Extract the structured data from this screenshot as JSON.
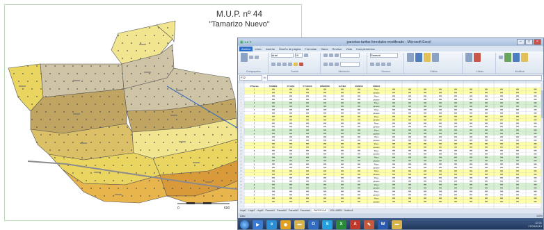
{
  "map": {
    "title_line1": "M.U.P. nº 44",
    "title_line2": "\"Tamarizo Nuevo\"",
    "scale_labels": [
      "0",
      "500"
    ],
    "colors": {
      "light_yellow": "#f1e58f",
      "yellow": "#ead561",
      "beige": "#cfc3a6",
      "tan": "#c0a562",
      "orange_light": "#e8b44c",
      "orange": "#d99b3a",
      "mustard": "#dcc067",
      "border": "#555555",
      "leader_line": "#3d6fb5"
    }
  },
  "excel": {
    "window_title": "parcelas tarifas forestales modificado - Microsoft Excel",
    "quick_access_icon": "excel-logo-icon",
    "ribbon_tabs": [
      "Archivo",
      "Inicio",
      "Insertar",
      "Diseño de página",
      "Fórmulas",
      "Datos",
      "Revisar",
      "Vista",
      "Complementos"
    ],
    "ribbon_groups": [
      "Portapapeles",
      "Fuente",
      "Alineación",
      "Número",
      "Estilos",
      "Celdas",
      "Modificar"
    ],
    "font_name": "Arial",
    "font_size": "10",
    "number_format": "General",
    "name_box": "F12",
    "fx_label": "fx",
    "column_headers": [
      "NºParcela",
      "NºARBOL",
      "Nº VARA",
      "Nº SAVIAS",
      "DIÁMETRO",
      "ALTURA",
      "ESPECIE",
      "CÓDIGO"
    ],
    "sheet_tabs": [
      "Hoja1",
      "Hoja2",
      "Hoja3",
      "Parcela1",
      "Parcela2",
      "Parcela3",
      "Parcela4",
      "PARCELAS",
      "VOLUMEN",
      "Gráfico1"
    ],
    "status_left": "Listo",
    "status_right": "100%",
    "row_data": [
      {
        "id": "1",
        "plot": "1",
        "label": "Pinus"
      },
      {
        "id": "2",
        "plot": "1",
        "label": "pinaster"
      },
      {
        "id": "3",
        "plot": "1",
        "label": "Pinus"
      },
      {
        "id": "4",
        "plot": "1",
        "label": "pinaster"
      },
      {
        "id": "5",
        "plot": "2",
        "label": "Pinus"
      },
      {
        "id": "6",
        "plot": "2",
        "label": "pinaster"
      },
      {
        "id": "7",
        "plot": "2",
        "label": "Pinus"
      },
      {
        "id": "8",
        "plot": "2",
        "label": "pinaster"
      },
      {
        "id": "9",
        "plot": "3",
        "label": "Pinus"
      },
      {
        "id": "10",
        "plot": "3",
        "label": "pinaster"
      },
      {
        "id": "11",
        "plot": "3",
        "label": "Pinus"
      },
      {
        "id": "12",
        "plot": "3",
        "label": "pinaster"
      },
      {
        "id": "13",
        "plot": "4",
        "label": "Pinus"
      },
      {
        "id": "14",
        "plot": "4",
        "label": "pinaster"
      },
      {
        "id": "15",
        "plot": "4",
        "label": "Pinus"
      },
      {
        "id": "16",
        "plot": "4",
        "label": "pinaster"
      },
      {
        "id": "17",
        "plot": "5",
        "label": "Pinus"
      },
      {
        "id": "18",
        "plot": "5",
        "label": "pinaster"
      },
      {
        "id": "19",
        "plot": "5",
        "label": "Pinus"
      },
      {
        "id": "20",
        "plot": "5",
        "label": "pinaster"
      },
      {
        "id": "21",
        "plot": "6",
        "label": "Pinus"
      },
      {
        "id": "22",
        "plot": "6",
        "label": "pinaster"
      },
      {
        "id": "23",
        "plot": "6",
        "label": "Pinus"
      },
      {
        "id": "24",
        "plot": "6",
        "label": "pinaster"
      },
      {
        "id": "25",
        "plot": "7",
        "label": "Pinus"
      },
      {
        "id": "26",
        "plot": "7",
        "label": "pinaster"
      },
      {
        "id": "27",
        "plot": "7",
        "label": "Pinus"
      },
      {
        "id": "28",
        "plot": "7",
        "label": "pinaster"
      },
      {
        "id": "29",
        "plot": "8",
        "label": "Pinus"
      },
      {
        "id": "30",
        "plot": "8",
        "label": "pinaster"
      },
      {
        "id": "31",
        "plot": "8",
        "label": "Pinus"
      },
      {
        "id": "32",
        "plot": "8",
        "label": "pinaster"
      },
      {
        "id": "33",
        "plot": "9",
        "label": "Pinus"
      },
      {
        "id": "34",
        "plot": "9",
        "label": "pinaster"
      }
    ],
    "taskbar_icons": [
      "start-orb-icon",
      "media-player-icon",
      "ie-icon",
      "chrome-icon",
      "folder-icon",
      "outlook-icon",
      "skype-icon",
      "excel-icon",
      "acrobat-icon",
      "paint-icon",
      "word-icon",
      "folder-icon"
    ],
    "tray_time": "12:31",
    "tray_date": "17/04/2013"
  }
}
